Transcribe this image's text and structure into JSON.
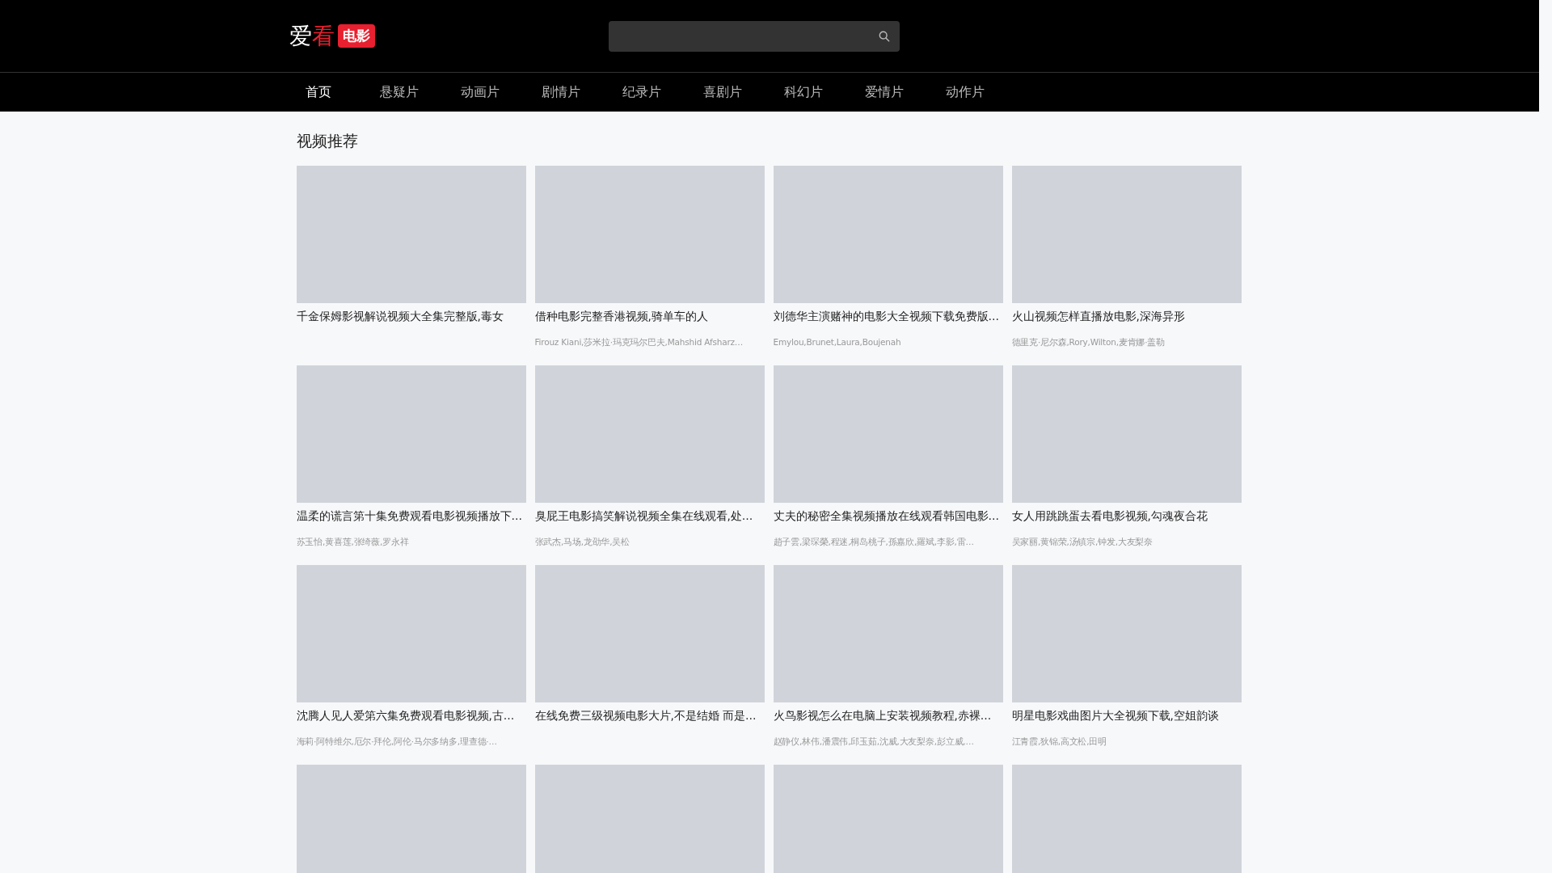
{
  "logo": {
    "parts": [
      {
        "text": "爱",
        "accent": false
      },
      {
        "text": "看",
        "accent": true
      }
    ],
    "badge": "电影"
  },
  "nav": [
    {
      "label": "首页",
      "selected": true
    },
    {
      "label": "悬疑片",
      "selected": false
    },
    {
      "label": "动画片",
      "selected": false
    },
    {
      "label": "剧情片",
      "selected": false
    },
    {
      "label": "纪录片",
      "selected": false
    },
    {
      "label": "喜剧片",
      "selected": false
    },
    {
      "label": "科幻片",
      "selected": false
    },
    {
      "label": "爱情片",
      "selected": false
    },
    {
      "label": "动作片",
      "selected": false
    }
  ],
  "section_title": "视频推荐",
  "cards": [
    {
      "title": "千金保姆影视解说视频大全集完整版,毒女"
    },
    {
      "title": "借种电影完整香港视频,骑单车的人",
      "actors": "Firouz Kiani,莎米拉·玛克玛尔巴夫,Mahshid Afsharz…"
    },
    {
      "title": "刘德华主演赌神的电影大全视频下载免费版…",
      "actors": "Emylou,Brunet,Laura,Boujenah"
    },
    {
      "title": "火山视频怎样直播放电影,深海异形",
      "actors": "德里克·尼尔森,Rory,Wilton,麦肯娜·盖勒"
    },
    {
      "title": "温柔的谎言第十集免费观看电影视频播放下…",
      "actors": "苏玉怡,黄喜莲,张绮薇,罗永祥"
    },
    {
      "title": "臭屁王电影搞笑解说视频全集在线观看,处…",
      "actors": "张武杰,马场,龙劭华,吴松"
    },
    {
      "title": "丈夫的秘密全集视频播放在线观看韩国电影…",
      "actors": "趙子雲,梁琛榮,程迷,桐岛桃子,孫嘉欣,羅斌,李影,雷…"
    },
    {
      "title": "女人用跳跳蛋去看电影视频,勾魂夜合花",
      "actors": "吴家丽,黄锦荣,汤镇宗,钟发,大友梨奈"
    },
    {
      "title": "沈腾人见人爱第六集免费观看电影视频,古…",
      "actors": "海莉·阿特维尔,厄尔·拜伦,阿伦·马尔多纳多,理查德·…"
    },
    {
      "title": "在线免费三级视频电影大片,不是结婚 而是…"
    },
    {
      "title": "火鸟影视怎么在电脑上安装视频教程,赤裸…",
      "actors": "赵静仪,林伟,潘震伟,邱玉茹,沈威,大友梨奈,彭立威,…"
    },
    {
      "title": "明星电影戏曲图片大全视频下载,空姐韵谈",
      "actors": "江青霞,狄锦,高文松,田明"
    },
    {
      "kind": "placeholder"
    },
    {
      "kind": "placeholder"
    },
    {
      "kind": "placeholder"
    },
    {
      "kind": "placeholder"
    }
  ]
}
